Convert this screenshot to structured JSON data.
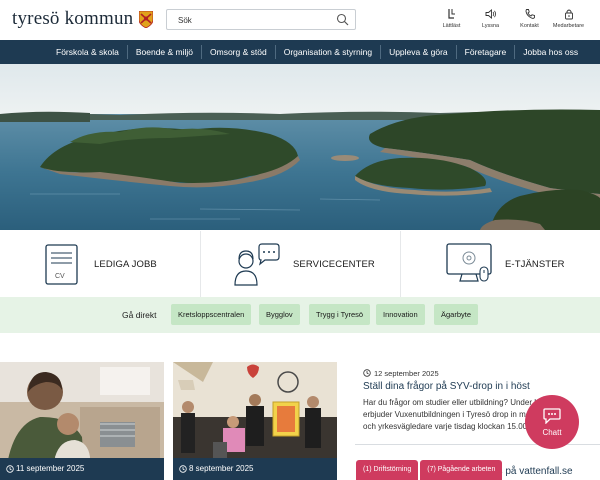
{
  "header": {
    "logo_text": "tyresö kommun",
    "search_placeholder": "Sök",
    "tools": [
      {
        "label": "Lättläst",
        "icon": "easy-read-icon"
      },
      {
        "label": "Lyssna",
        "icon": "speaker-icon"
      },
      {
        "label": "Kontakt",
        "icon": "phone-icon"
      },
      {
        "label": "Medarbetare",
        "icon": "lock-icon"
      }
    ]
  },
  "nav": {
    "items": [
      "Förskola & skola",
      "Boende & miljö",
      "Omsorg & stöd",
      "Organisation & styrning",
      "Uppleva & göra",
      "Företagare",
      "Jobba hos oss"
    ]
  },
  "services": [
    {
      "label": "LEDIGA JOBB",
      "icon": "cv-document-icon",
      "icon_text": "CV"
    },
    {
      "label": "SERVICECENTER",
      "icon": "customer-service-icon"
    },
    {
      "label": "E-TJÄNSTER",
      "icon": "computer-settings-icon"
    }
  ],
  "direct": {
    "title": "Gå direkt",
    "links": [
      "Kretsloppscentralen",
      "Bygglov",
      "Trygg i Tyresö",
      "Innovation",
      "Ägarbyte"
    ]
  },
  "news": {
    "cards": [
      {
        "date": "11 september 2025"
      },
      {
        "date": "8 september 2025"
      }
    ],
    "list": [
      {
        "date": "12 september 2025",
        "title": "Ställ dina frågor på SYV-drop in i höst",
        "text": "Har du frågor om studier eller utbildning? Under hösten erbjuder Vuxenutbildningen i Tyresö drop in med studie- och yrkesvägledare varje tisdag klockan 15.00–16.00."
      },
      {
        "title_fragment": "os på vattenfall.se"
      }
    ]
  },
  "chat": {
    "label": "Chatt"
  },
  "alerts": [
    {
      "label": "(1) Driftstörning"
    },
    {
      "label": "(7) Pågående arbeten"
    }
  ],
  "colors": {
    "navy": "#1e3a52",
    "accent_pink": "#cf3b5f",
    "direct_bg": "#e6f3e6",
    "chip_bg": "#c5e6c5"
  }
}
